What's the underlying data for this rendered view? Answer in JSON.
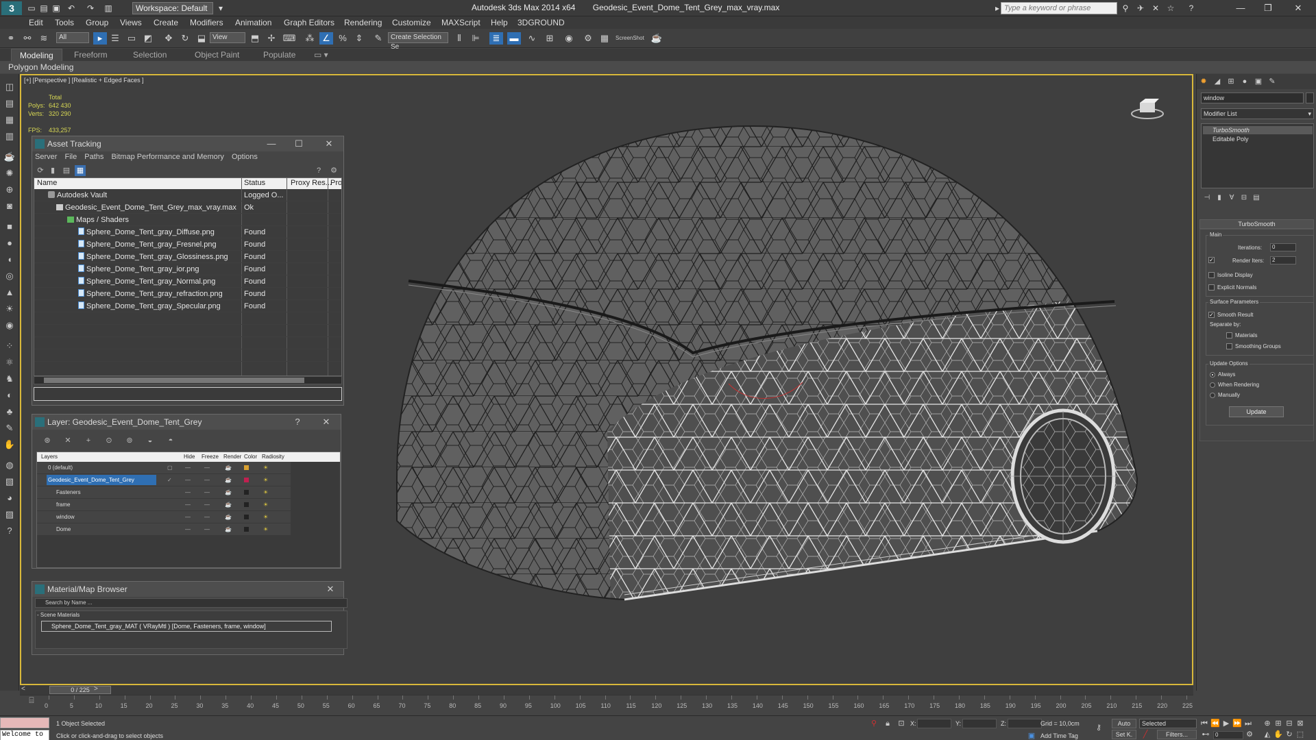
{
  "window": {
    "app_title": "Autodesk 3ds Max  2014 x64",
    "file_title": "Geodesic_Event_Dome_Tent_Grey_max_vray.max",
    "workspace": "Workspace: Default",
    "search_placeholder": "Type a keyword or phrase",
    "logo": "3"
  },
  "menu": [
    "Edit",
    "Tools",
    "Group",
    "Views",
    "Create",
    "Modifiers",
    "Animation",
    "Graph Editors",
    "Rendering",
    "Customize",
    "MAXScript",
    "Help",
    "3DGROUND"
  ],
  "toolbar": {
    "selection_filter": "All",
    "ref_coord": "View",
    "named_selection": "Create Selection Se",
    "screenshot_label": "ScreenShot"
  },
  "ribbon": {
    "tabs": [
      "Modeling",
      "Freeform",
      "Selection",
      "Object Paint",
      "Populate"
    ],
    "sub_label": "Polygon Modeling"
  },
  "viewport": {
    "label": "[+] [Perspective ] [Realistic + Edged Faces ]",
    "stats": {
      "total_label": "Total",
      "polys_label": "Polys:",
      "polys_value": "642 430",
      "verts_label": "Verts:",
      "verts_value": "320 290",
      "fps_label": "FPS:",
      "fps_value": "433,257"
    }
  },
  "asset_tracking": {
    "title": "Asset Tracking",
    "menu": [
      "Server",
      "File",
      "Paths",
      "Bitmap Performance and Memory",
      "Options"
    ],
    "columns": [
      "Name",
      "Status",
      "Proxy Res...",
      "Pro"
    ],
    "rows": [
      {
        "name": "Autodesk Vault",
        "status": "Logged O..."
      },
      {
        "name": "Geodesic_Event_Dome_Tent_Grey_max_vray.max",
        "status": "Ok"
      },
      {
        "name": "Maps / Shaders",
        "status": ""
      },
      {
        "name": "Sphere_Dome_Tent_gray_Diffuse.png",
        "status": "Found"
      },
      {
        "name": "Sphere_Dome_Tent_gray_Fresnel.png",
        "status": "Found"
      },
      {
        "name": "Sphere_Dome_Tent_gray_Glossiness.png",
        "status": "Found"
      },
      {
        "name": "Sphere_Dome_Tent_gray_ior.png",
        "status": "Found"
      },
      {
        "name": "Sphere_Dome_Tent_gray_Normal.png",
        "status": "Found"
      },
      {
        "name": "Sphere_Dome_Tent_gray_refraction.png",
        "status": "Found"
      },
      {
        "name": "Sphere_Dome_Tent_gray_Specular.png",
        "status": "Found"
      }
    ]
  },
  "layer_panel": {
    "title": "Layer: Geodesic_Event_Dome_Tent_Grey",
    "help": "?",
    "columns": [
      "Layers",
      "Hide",
      "Freeze",
      "Render",
      "Color",
      "Radiosity"
    ],
    "rows": [
      {
        "name": "0 (default)",
        "color": "#d8a030"
      },
      {
        "name": "Geodesic_Event_Dome_Tent_Grey",
        "color": "#c02050"
      },
      {
        "name": "Fasteners",
        "color": "#222222"
      },
      {
        "name": "frame",
        "color": "#222222"
      },
      {
        "name": "window",
        "color": "#222222"
      },
      {
        "name": "Dome",
        "color": "#222222"
      }
    ],
    "dash": "—"
  },
  "material_browser": {
    "title": "Material/Map Browser",
    "search_placeholder": "Search by Name ...",
    "group_title": "- Scene Materials",
    "item": "Sphere_Dome_Tent_gray_MAT ( VRayMtl ) [Dome, Fasteners, frame, window]"
  },
  "command_panel": {
    "object_name": "window",
    "modifier_list": "Modifier List",
    "stack": [
      "TurboSmooth",
      "Editable Poly"
    ],
    "turbosmooth": {
      "title": "TurboSmooth",
      "main_label": "Main",
      "iterations_label": "Iterations:",
      "iterations_value": "0",
      "render_iters_label": "Render Iters:",
      "render_iters_value": "2",
      "isoline_label": "Isoline Display",
      "explicit_label": "Explicit Normals",
      "surface_label": "Surface Parameters",
      "smooth_result_label": "Smooth Result",
      "separate_label": "Separate by:",
      "materials_label": "Materials",
      "smoothing_label": "Smoothing Groups",
      "update_label": "Update Options",
      "always_label": "Always",
      "when_rendering_label": "When Rendering",
      "manually_label": "Manually",
      "update_button": "Update"
    }
  },
  "timeline": {
    "slider_label": "0 / 225",
    "ticks": [
      "0",
      "5",
      "10",
      "15",
      "20",
      "25",
      "30",
      "35",
      "40",
      "45",
      "50",
      "55",
      "60",
      "65",
      "70",
      "75",
      "80",
      "85",
      "90",
      "95",
      "100",
      "105",
      "110",
      "115",
      "120",
      "125",
      "130",
      "135",
      "140",
      "145",
      "150",
      "155",
      "160",
      "165",
      "170",
      "175",
      "180",
      "185",
      "190",
      "195",
      "200",
      "205",
      "210",
      "215",
      "220",
      "225"
    ]
  },
  "status": {
    "maxscript_text": "Welcome to",
    "selected_text": "1 Object Selected",
    "prompt_text": "Click or click-and-drag to select objects",
    "x_label": "X:",
    "y_label": "Y:",
    "z_label": "Z:",
    "grid_text": "Grid = 10,0cm",
    "auto_label": "Auto",
    "selected_option": "Selected",
    "setk_label": "Set K.",
    "filters_label": "Filters...",
    "add_time_tag": "Add Time Tag",
    "frame_value": "0"
  }
}
